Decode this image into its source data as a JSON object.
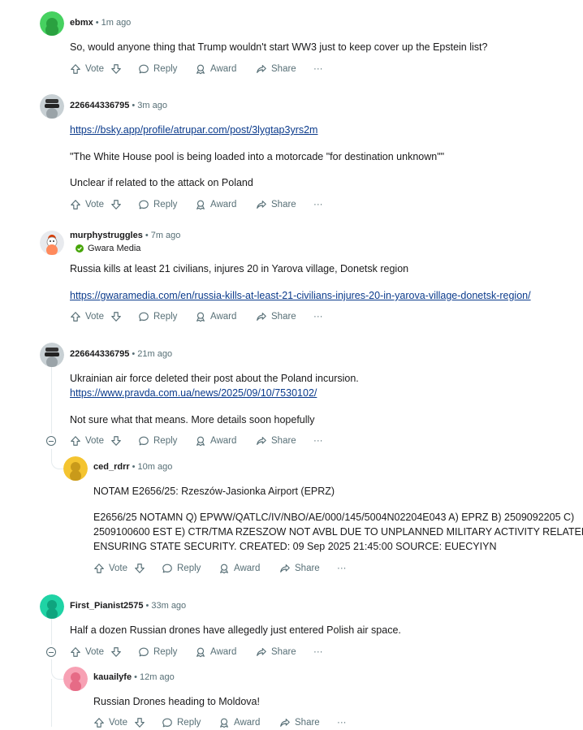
{
  "colors": {
    "link": "#0b3b8c",
    "meta": "#576f76",
    "text": "#1a1a1b",
    "verified": "#46a508"
  },
  "actions": {
    "vote": "Vote",
    "reply": "Reply",
    "award": "Award",
    "share": "Share",
    "more": "···"
  },
  "comments": [
    {
      "user": "ebmx",
      "time": "1m ago",
      "avatar_color": "#46d160",
      "lines": [
        "So, would anyone thing that Trump wouldn't start WW3 just to keep cover up the Epstein list?"
      ]
    },
    {
      "user": "226644336795",
      "time": "3m ago",
      "avatar_color": "#c8d0d4",
      "link": "https://bsky.app/profile/atrupar.com/post/3lygtap3yrs2m",
      "lines": [
        "\"The White House pool is being loaded into a motorcade \"for destination unknown\"\"",
        "Unclear if related to the attack on Poland"
      ]
    },
    {
      "user": "murphystruggles",
      "time": "7m ago",
      "avatar_color": "#e8eaee",
      "flair": "Gwara Media",
      "lines": [
        "Russia kills at least 21 civilians, injures 20 in Yarova village, Donetsk region"
      ],
      "link": "https://gwaramedia.com/en/russia-kills-at-least-21-civilians-injures-20-in-yarova-village-donetsk-region/"
    },
    {
      "user": "226644336795",
      "time": "21m ago",
      "avatar_color": "#c8d0d4",
      "lines": [
        "Ukrainian air force deleted their post about the Poland incursion.",
        "Not sure what that means. More details soon hopefully"
      ],
      "link": "https://www.pravda.com.ua/news/2025/09/10/7530102/"
    },
    {
      "user": "ced_rdrr",
      "time": "10m ago",
      "avatar_color": "#f4c430",
      "lines": [
        "NOTAM E2656/25: Rzeszów-Jasionka Airport (EPRZ)",
        "E2656/25 NOTAMN Q) EPWW/QATLC/IV/NBO/AE/000/145/5004N02204E043 A) EPRZ B) 2509092205 C)",
        "2509100600 EST E) CTR/TMA RZESZOW NOT AVBL DUE TO UNPLANNED MILITARY ACTIVITY RELATED TO",
        "ENSURING STATE SECURITY. CREATED: 09 Sep 2025 21:45:00 SOURCE: EUECYIYN"
      ]
    },
    {
      "user": "First_Pianist2575",
      "time": "33m ago",
      "avatar_color": "#1fd3a5",
      "lines": [
        "Half a dozen Russian drones have allegedly just entered Polish air space."
      ]
    },
    {
      "user": "kauailyfe",
      "time": "12m ago",
      "avatar_color": "#f7a1b4",
      "lines": [
        "Russian Drones heading to Moldova!"
      ]
    }
  ]
}
